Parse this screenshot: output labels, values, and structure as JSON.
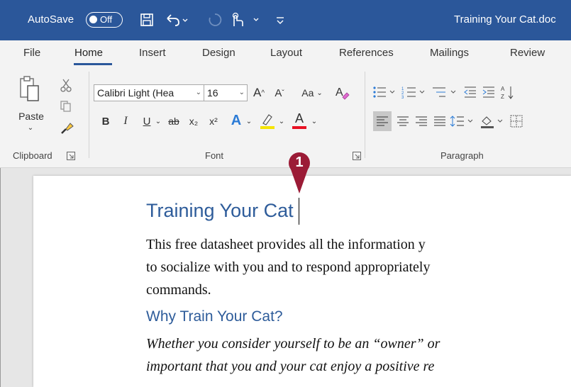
{
  "titlebar": {
    "autosave_label": "AutoSave",
    "toggle_state": "Off",
    "document_title": "Training Your Cat.doc",
    "bg_color": "#2b579a"
  },
  "tabs": [
    {
      "label": "File"
    },
    {
      "label": "Home",
      "active": true
    },
    {
      "label": "Insert"
    },
    {
      "label": "Design"
    },
    {
      "label": "Layout"
    },
    {
      "label": "References"
    },
    {
      "label": "Mailings"
    },
    {
      "label": "Review"
    }
  ],
  "ribbon": {
    "clipboard": {
      "paste_label": "Paste",
      "group_label": "Clipboard"
    },
    "font": {
      "font_name": "Calibri Light (Hea",
      "font_size": "16",
      "group_label": "Font",
      "bold": "B",
      "italic": "I",
      "underline": "U",
      "strikethrough": "ab",
      "subscript": "x₂",
      "superscript": "x²",
      "grow": "A^",
      "shrink": "Aˇ",
      "change_case": "Aa",
      "text_effects": "A",
      "font_color": "A",
      "highlight_color": "#f5e400",
      "font_color_value": "#e81123"
    },
    "paragraph": {
      "group_label": "Paragraph"
    }
  },
  "document": {
    "heading1": "Training Your Cat",
    "paragraph_lines": [
      "This free datasheet provides all the information y",
      "to socialize with you and to respond appropriately",
      "commands."
    ],
    "heading2": "Why Train Your Cat?",
    "italic_lines": [
      "Whether you consider yourself to be an “owner” or",
      "important that you and your cat enjoy a positive re"
    ],
    "heading_color": "#2e5c9a"
  },
  "callout": {
    "number": "1",
    "color": "#9b1b36"
  }
}
